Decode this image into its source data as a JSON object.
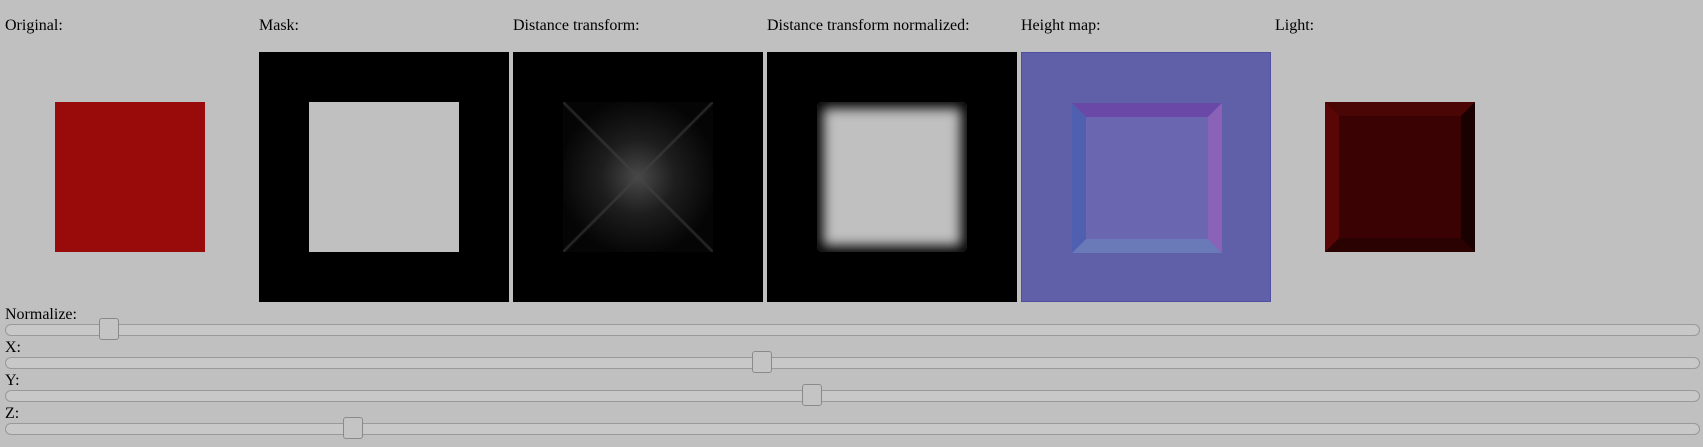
{
  "panels": {
    "original": {
      "label": "Original:",
      "color": "#990a0a"
    },
    "mask": {
      "label": "Mask:"
    },
    "distance_transform": {
      "label": "Distance transform:"
    },
    "distance_transform_normalized": {
      "label": "Distance transform normalized:"
    },
    "height_map": {
      "label": "Height map:",
      "color": "#6060a8"
    },
    "light": {
      "label": "Light:",
      "color": "#3a0202"
    }
  },
  "sliders": {
    "normalize": {
      "label": "Normalize:",
      "value_fraction": 0.056
    },
    "x": {
      "label": "X:",
      "value_fraction": 0.446
    },
    "y": {
      "label": "Y:",
      "value_fraction": 0.476
    },
    "z": {
      "label": "Z:",
      "value_fraction": 0.202
    }
  }
}
